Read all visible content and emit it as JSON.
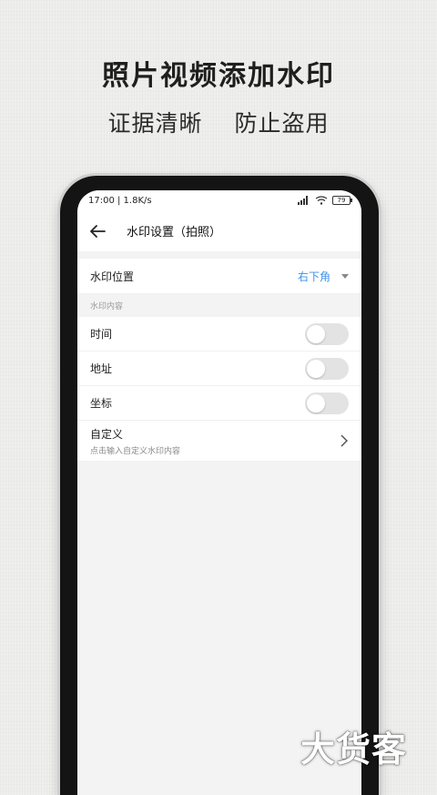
{
  "promo": {
    "headline": "照片视频添加水印",
    "subline_left": "证据清晰",
    "subline_right": "防止盗用"
  },
  "statusbar": {
    "time_speed": "17:00 | 1.8K/s",
    "battery": "79"
  },
  "header": {
    "title": "水印设置（拍照）"
  },
  "position_row": {
    "label": "水印位置",
    "value": "右下角"
  },
  "content_section": {
    "heading": "水印内容",
    "items": [
      {
        "label": "时间",
        "enabled": false
      },
      {
        "label": "地址",
        "enabled": false
      },
      {
        "label": "坐标",
        "enabled": false
      }
    ]
  },
  "custom_row": {
    "label": "自定义",
    "hint": "点击输入自定义水印内容"
  },
  "watermark": {
    "brand": "大货客"
  },
  "colors": {
    "accent": "#3c91e6",
    "switch_off": "#e3e3e3"
  }
}
